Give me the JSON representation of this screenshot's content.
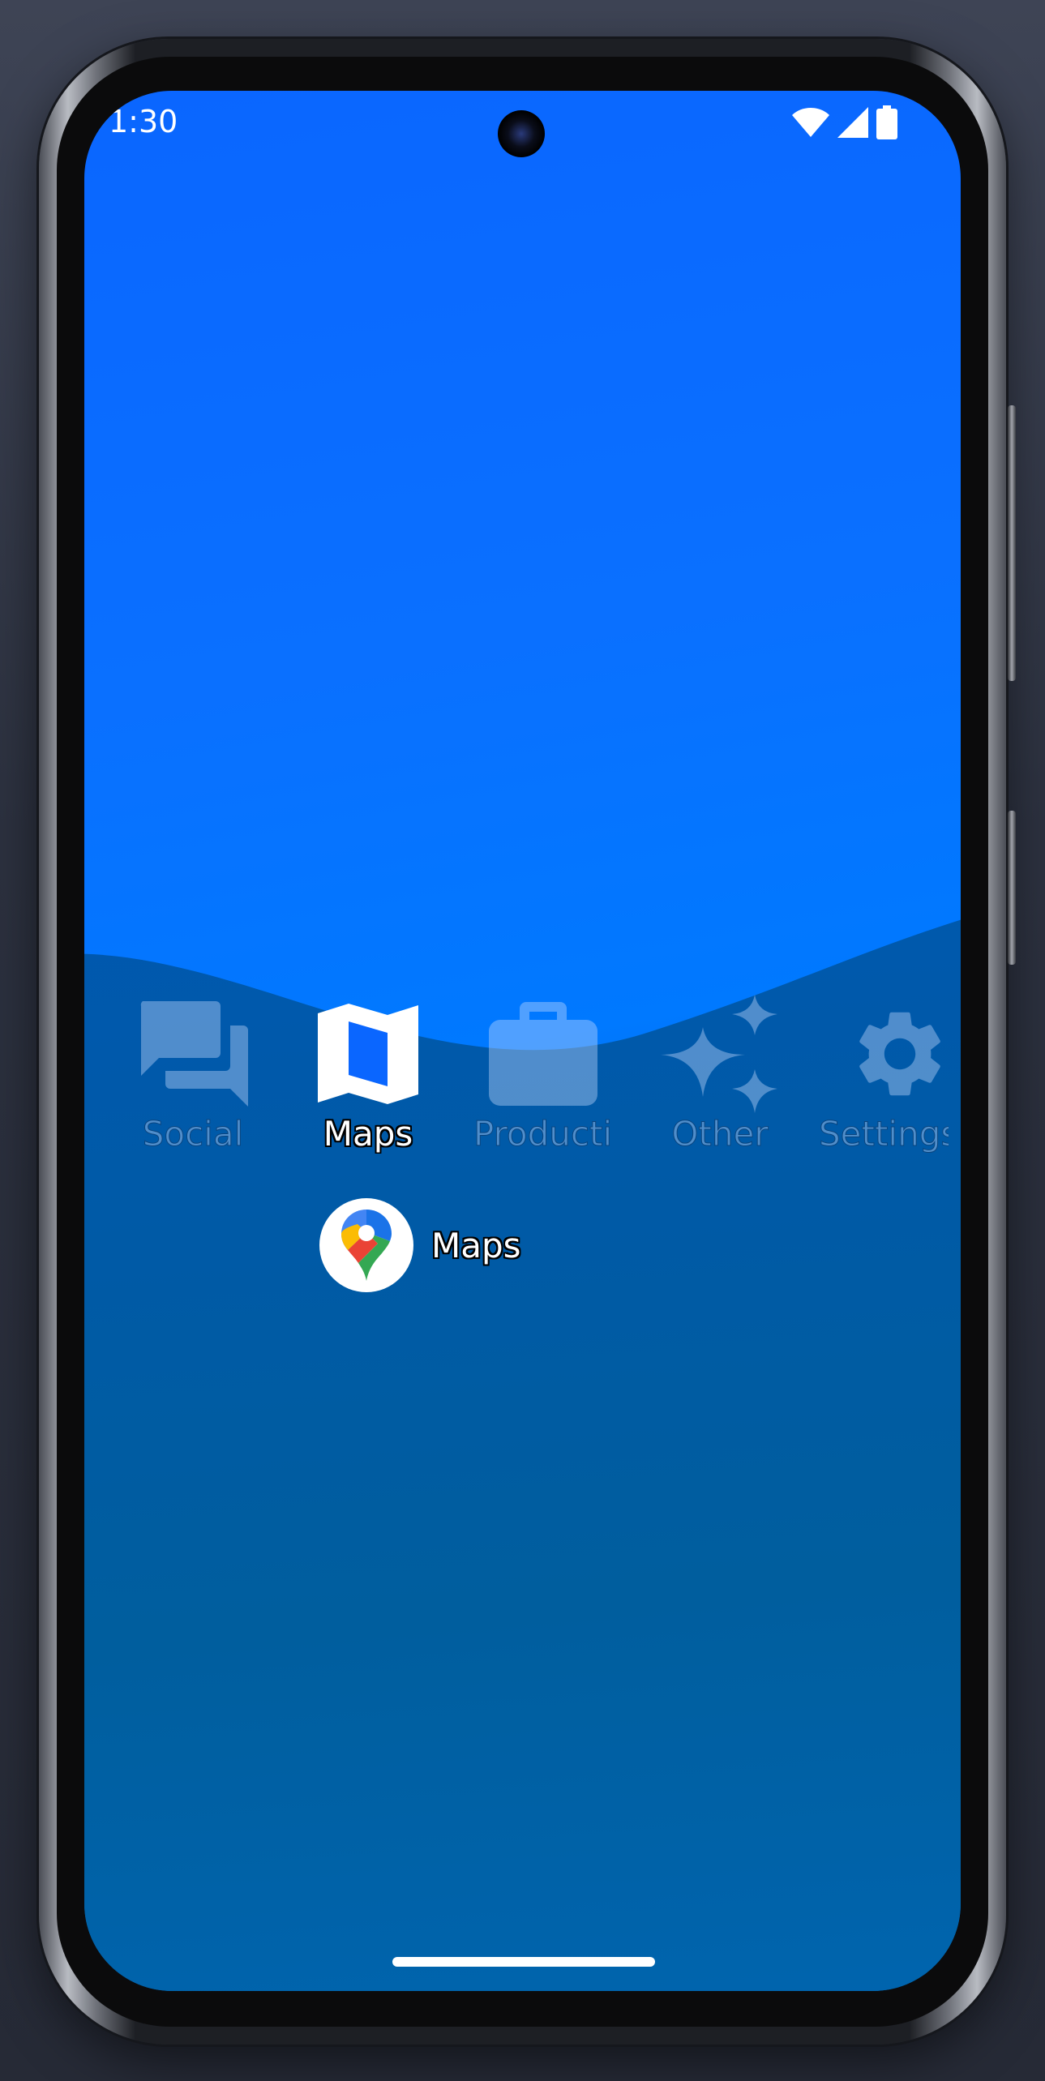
{
  "status_bar": {
    "time": "1:30",
    "icons": [
      "wifi-icon",
      "signal-icon",
      "battery-icon"
    ]
  },
  "category_tabs": [
    {
      "label": "Social",
      "icon": "chat-bubbles-icon",
      "active": false
    },
    {
      "label": "Maps",
      "icon": "folded-map-icon",
      "active": true
    },
    {
      "label": "Productiv",
      "icon": "briefcase-icon",
      "active": false
    },
    {
      "label": "Other",
      "icon": "sparkles-icon",
      "active": false
    },
    {
      "label": "Settings",
      "icon": "gear-icon",
      "active": false
    }
  ],
  "apps": [
    {
      "label": "Maps",
      "icon": "google-maps-pin-icon"
    }
  ],
  "colors": {
    "wallpaper_top": "#0a66ff",
    "wallpaper_bottom": "#0056a8",
    "label_text": "#ffffff",
    "dim_icon": "#c7dcff"
  }
}
